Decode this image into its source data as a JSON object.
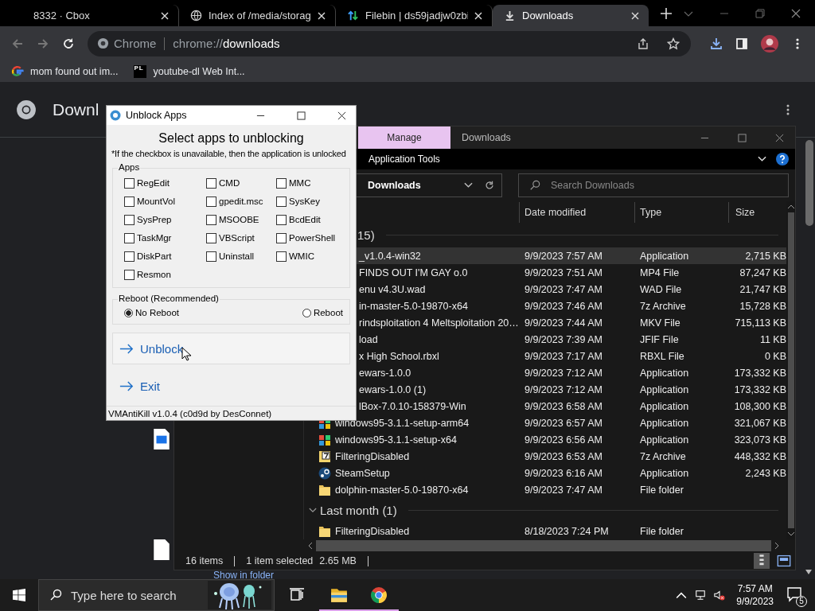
{
  "browser": {
    "tabs": [
      {
        "title": "8332 · Cbox",
        "selected": false
      },
      {
        "title": "Index of /media/storag",
        "selected": false
      },
      {
        "title": "Filebin | ds59jadjw0zbi",
        "selected": false
      },
      {
        "title": "Downloads",
        "selected": true
      }
    ],
    "omnibox": {
      "chip": "Chrome",
      "url_scheme": "chrome://",
      "url_path": "downloads"
    },
    "bookmarks": [
      {
        "title": "mom found out im..."
      },
      {
        "title": "youtube-dl Web Int...",
        "icon_letters": "PL"
      }
    ]
  },
  "downloads_page": {
    "title": "Downl",
    "link": "Show in folder"
  },
  "explorer": {
    "context_tab": "Manage",
    "title": "Downloads",
    "ribbon_label": "Application Tools",
    "breadcrumb": "Downloads",
    "search_placeholder": "Search Downloads",
    "columns": [
      "Date modified",
      "Type",
      "Size"
    ],
    "groups": [
      {
        "label": "15)",
        "rows": [
          {
            "name": "_v1.0.4-win32",
            "date": "9/9/2023 7:57 AM",
            "type": "Application",
            "size": "2,715 KB",
            "selected": true
          },
          {
            "name": "FINDS OUT I'M GAY o.0",
            "date": "9/9/2023 7:51 AM",
            "type": "MP4 File",
            "size": "87,247 KB",
            "selected": false
          },
          {
            "name": "enu v4.3U.wad",
            "date": "9/9/2023 7:47 AM",
            "type": "WAD File",
            "size": "21,747 KB",
            "selected": false
          },
          {
            "name": "in-master-5.0-19870-x64",
            "date": "9/9/2023 7:46 AM",
            "type": "7z Archive",
            "size": "15,728 KB",
            "selected": false
          },
          {
            "name": "rindsploitation 4 Meltsploitation 20…",
            "date": "9/9/2023 7:44 AM",
            "type": "MKV File",
            "size": "715,113 KB",
            "selected": false
          },
          {
            "name": "load",
            "date": "9/9/2023 7:39 AM",
            "type": "JFIF File",
            "size": "11 KB",
            "selected": false
          },
          {
            "name": "x High School.rbxl",
            "date": "9/9/2023 7:17 AM",
            "type": "RBXL File",
            "size": "0 KB",
            "selected": false
          },
          {
            "name": "ewars-1.0.0",
            "date": "9/9/2023 7:12 AM",
            "type": "Application",
            "size": "173,332 KB",
            "selected": false
          },
          {
            "name": "ewars-1.0.0 (1)",
            "date": "9/9/2023 7:12 AM",
            "type": "Application",
            "size": "173,332 KB",
            "selected": false
          },
          {
            "name": "lBox-7.0.10-158379-Win",
            "date": "9/9/2023 6:58 AM",
            "type": "Application",
            "size": "108,300 KB",
            "selected": false
          },
          {
            "kind": "app",
            "name": "windows95-3.1.1-setup-arm64",
            "date": "9/9/2023 6:57 AM",
            "type": "Application",
            "size": "321,067 KB",
            "selected": false
          },
          {
            "kind": "app",
            "name": "windows95-3.1.1-setup-x64",
            "date": "9/9/2023 6:56 AM",
            "type": "Application",
            "size": "323,073 KB",
            "selected": false
          },
          {
            "kind": "archive",
            "name": "FilteringDisabled",
            "date": "9/9/2023 6:53 AM",
            "type": "7z Archive",
            "size": "448,332 KB",
            "selected": false
          },
          {
            "kind": "steam",
            "name": "SteamSetup",
            "date": "9/9/2023 6:16 AM",
            "type": "Application",
            "size": "2,243 KB",
            "selected": false
          },
          {
            "kind": "folder",
            "name": "dolphin-master-5.0-19870-x64",
            "date": "9/9/2023 7:47 AM",
            "type": "File folder",
            "selected": false
          }
        ]
      },
      {
        "label": "Last month (1)",
        "rows": [
          {
            "kind": "folder",
            "name": "FilteringDisabled",
            "date": "8/18/2023 7:24 PM",
            "type": "File folder",
            "selected": false
          }
        ]
      }
    ],
    "status": [
      "16 items",
      "1 item selected",
      "2.65 MB"
    ]
  },
  "dialog": {
    "title": "Unblock Apps",
    "heading": "Select apps to unblocking",
    "note": "*If the checkbox is unavailable, then the application is unlocked",
    "apps_label": "Apps",
    "apps": [
      {
        "label": "RegEdit",
        "checked": false
      },
      {
        "label": "CMD",
        "checked": false
      },
      {
        "label": "MMC",
        "checked": false
      },
      {
        "label": "MountVol",
        "checked": false
      },
      {
        "label": "gpedit.msc",
        "checked": false
      },
      {
        "label": "SysKey",
        "checked": false
      },
      {
        "label": "SysPrep",
        "checked": false
      },
      {
        "label": "MSOOBE",
        "checked": false
      },
      {
        "label": "BcdEdit",
        "checked": false
      },
      {
        "label": "TaskMgr",
        "checked": false
      },
      {
        "label": "VBScript",
        "checked": false
      },
      {
        "label": "PowerShell",
        "checked": false
      },
      {
        "label": "DiskPart",
        "checked": false
      },
      {
        "label": "Uninstall",
        "checked": false
      },
      {
        "label": "WMIC",
        "checked": false
      },
      {
        "label": "Resmon",
        "checked": false
      }
    ],
    "reboot_label": "Reboot (Recommended)",
    "reboot_options": [
      {
        "label": "No Reboot",
        "selected": true
      },
      {
        "label": "Reboot",
        "selected": false
      }
    ],
    "actions": [
      {
        "label": "Unblock",
        "hovered": true
      },
      {
        "label": "Exit",
        "hovered": false
      }
    ],
    "status": "VMAntiKill v1.0.4 (c0d9d by DesConnet)"
  },
  "taskbar": {
    "search_placeholder": "Type here to search",
    "time": "7:57 AM",
    "date": "9/9/2023",
    "notifications": "5"
  }
}
